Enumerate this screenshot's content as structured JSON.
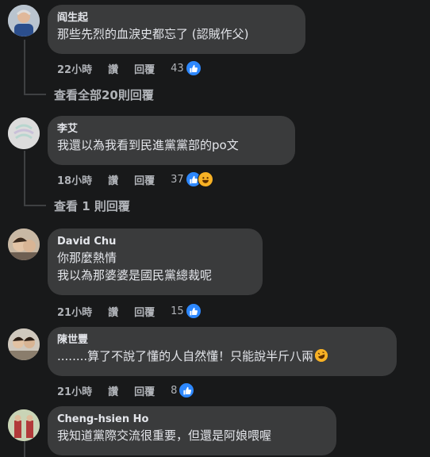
{
  "comments": [
    {
      "author": "阎生起",
      "lines": [
        "那些先烈的血淚史都忘了 (認賊作父)"
      ],
      "time": "22小時",
      "like": "讚",
      "reply": "回覆",
      "reactions": "43",
      "view_replies": "查看全部20則回覆"
    },
    {
      "author": "李艾",
      "lines": [
        "我還以為我看到民進黨黨部的po文"
      ],
      "time": "18小時",
      "like": "讚",
      "reply": "回覆",
      "reactions": "37",
      "view_replies": "查看 1 則回覆"
    },
    {
      "author": "David Chu",
      "lines": [
        "你那麼熱情",
        "我以為那婆婆是國民黨總裁呢"
      ],
      "time": "21小時",
      "like": "讚",
      "reply": "回覆",
      "reactions": "15"
    },
    {
      "author": "陳世豐",
      "lines": [
        "........算了不說了懂的人自然懂！只能說半斤八兩"
      ],
      "time": "21小時",
      "like": "讚",
      "reply": "回覆",
      "reactions": "8"
    },
    {
      "author": "Cheng-hsien Ho",
      "lines": [
        "我知道黨際交流很重要，但還是阿娘喂喔"
      ]
    }
  ],
  "colors": {
    "background": "#18191a",
    "bubble": "#3a3b3c",
    "like_blue": "#2d88ff",
    "haha_yellow": "#f7b125",
    "secondary_text": "#b0b3b8"
  },
  "icons": [
    "like-reaction-icon",
    "haha-reaction-icon",
    "rofl-emoji-icon"
  ]
}
